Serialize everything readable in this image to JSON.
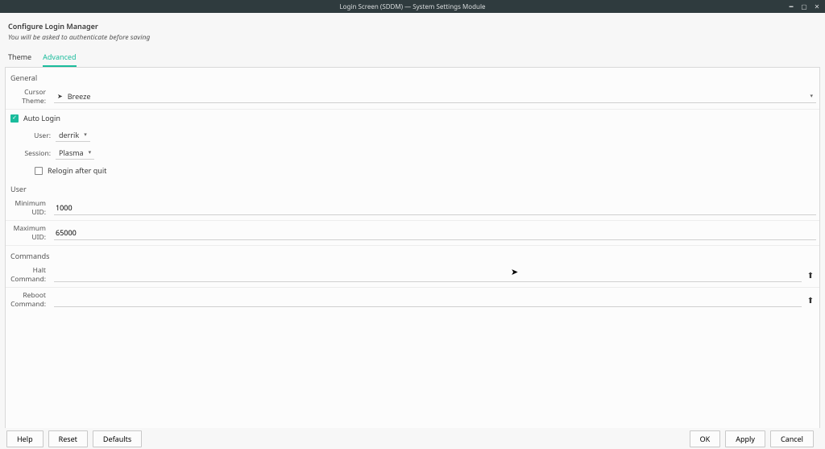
{
  "window": {
    "title": "Login Screen (SDDM) — System Settings Module"
  },
  "header": {
    "title": "Configure Login Manager",
    "subtitle": "You will be asked to authenticate before saving"
  },
  "tabs": {
    "theme": "Theme",
    "advanced": "Advanced"
  },
  "sections": {
    "general": "General",
    "user": "User",
    "commands": "Commands"
  },
  "general": {
    "cursor_theme_label": "Cursor Theme:",
    "cursor_theme_value": "Breeze",
    "auto_login_label": "Auto Login",
    "auto_login_checked": true,
    "user_label": "User:",
    "user_value": "derrik",
    "session_label": "Session:",
    "session_value": "Plasma",
    "relogin_label": "Relogin after quit",
    "relogin_checked": false
  },
  "user": {
    "min_uid_label": "Minimum UID:",
    "min_uid_value": "1000",
    "max_uid_label": "Maximum UID:",
    "max_uid_value": "65000"
  },
  "commands": {
    "halt_label": "Halt Command:",
    "halt_value": "",
    "reboot_label": "Reboot Command:",
    "reboot_value": ""
  },
  "footer": {
    "help": "Help",
    "reset": "Reset",
    "defaults": "Defaults",
    "ok": "OK",
    "apply": "Apply",
    "cancel": "Cancel"
  }
}
